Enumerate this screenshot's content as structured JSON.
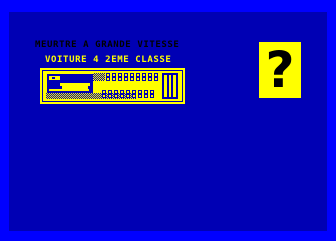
{
  "header": {
    "line1": "MEURTRE A GRANDE VITESSE",
    "line2": "VOITURE 4 2EME CLASSE"
  },
  "hint": {
    "symbol": "?",
    "icon": "question-mark-icon"
  },
  "plan": {
    "icon": "train-car-plan-icon"
  },
  "colors": {
    "background": "#0000ff",
    "play_area": "#0000b4",
    "yellow": "#ffff00",
    "black": "#000000"
  }
}
